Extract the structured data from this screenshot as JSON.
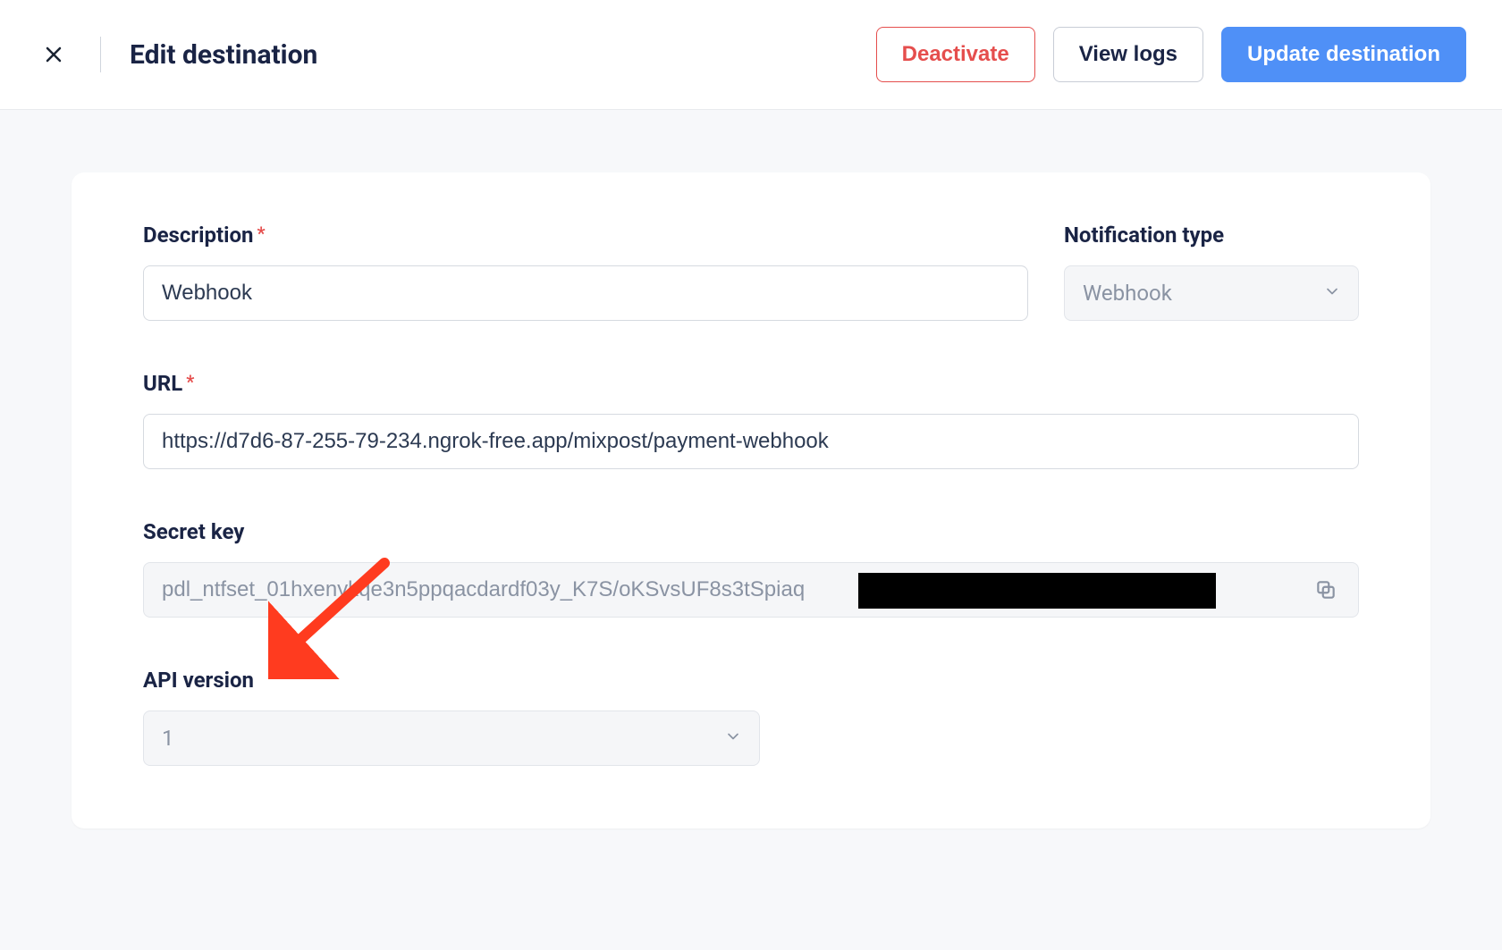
{
  "header": {
    "title": "Edit destination",
    "deactivate_label": "Deactivate",
    "view_logs_label": "View logs",
    "update_label": "Update destination"
  },
  "form": {
    "description": {
      "label": "Description",
      "required": true,
      "value": "Webhook"
    },
    "notification_type": {
      "label": "Notification type",
      "value": "Webhook"
    },
    "url": {
      "label": "URL",
      "required": true,
      "value": "https://d7d6-87-255-79-234.ngrok-free.app/mixpost/payment-webhook"
    },
    "secret_key": {
      "label": "Secret key",
      "value": "pdl_ntfset_01hxenykqe3n5ppqacdardf03y_K7S/oKSvsUF8s3tSpiaq"
    },
    "api_version": {
      "label": "API version",
      "value": "1"
    }
  }
}
